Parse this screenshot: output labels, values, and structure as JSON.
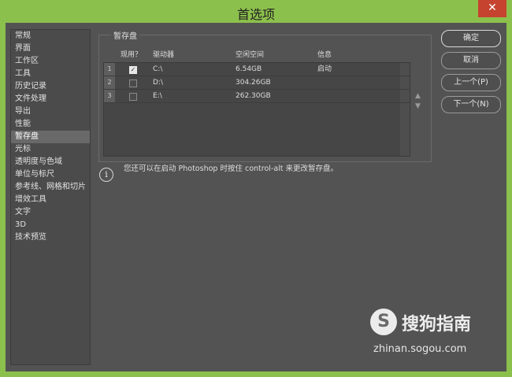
{
  "window": {
    "title": "首选项",
    "close_glyph": "✕"
  },
  "sidebar": {
    "items": [
      {
        "label": "常规"
      },
      {
        "label": "界面"
      },
      {
        "label": "工作区"
      },
      {
        "label": "工具"
      },
      {
        "label": "历史记录"
      },
      {
        "label": "文件处理"
      },
      {
        "label": "导出"
      },
      {
        "label": "性能"
      },
      {
        "label": "暂存盘",
        "active": true
      },
      {
        "label": "光标"
      },
      {
        "label": "透明度与色域"
      },
      {
        "label": "单位与标尺"
      },
      {
        "label": "参考线、网格和切片"
      },
      {
        "label": "增效工具"
      },
      {
        "label": "文字"
      },
      {
        "label": "3D"
      },
      {
        "label": "技术预览"
      }
    ]
  },
  "scratch": {
    "group_title": "暂存盘",
    "columns": {
      "active": "现用？",
      "drive": "驱动器",
      "free": "空闲空间",
      "info": "信息"
    },
    "rows": [
      {
        "num": "1",
        "checked": true,
        "drive": "C:\\",
        "free": "6.54GB",
        "info": "启动"
      },
      {
        "num": "2",
        "checked": false,
        "drive": "D:\\",
        "free": "304.26GB",
        "info": ""
      },
      {
        "num": "3",
        "checked": false,
        "drive": "E:\\",
        "free": "262.30GB",
        "info": ""
      }
    ],
    "move_up": "▲",
    "move_down": "▼"
  },
  "info": {
    "icon": "i",
    "text": "您还可以在启动 Photoshop 时按住 control-alt 来更改暂存盘。"
  },
  "buttons": {
    "ok": "确定",
    "cancel": "取消",
    "prev": "上一个(P)",
    "next": "下一个(N)"
  },
  "watermark": {
    "logo_letter": "S",
    "name": "搜狗指南",
    "url": "zhinan.sogou.com"
  },
  "colors": {
    "frame": "#8cc04c",
    "panel": "#535353",
    "close": "#c5432f"
  }
}
